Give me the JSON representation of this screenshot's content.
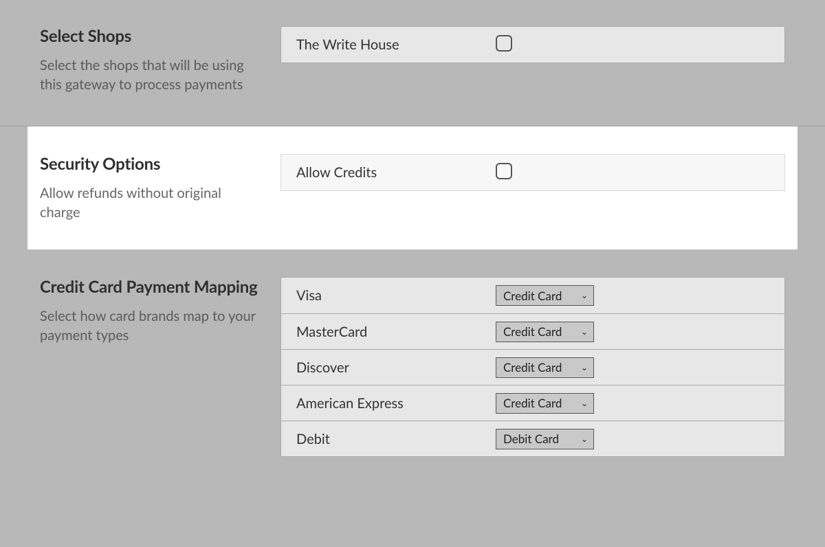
{
  "shops": {
    "title": "Select Shops",
    "desc": "Select the shops that will be using this gateway to process payments",
    "option_label": "The Write House",
    "option_checked": false
  },
  "security": {
    "title": "Security Options",
    "desc": "Allow refunds without original charge",
    "option_label": "Allow Credits",
    "option_checked": false
  },
  "mapping": {
    "title": "Credit Card Payment Mapping",
    "desc": "Select how card brands map to your payment types",
    "rows": [
      {
        "brand": "Visa",
        "value": "Credit Card"
      },
      {
        "brand": "MasterCard",
        "value": "Credit Card"
      },
      {
        "brand": "Discover",
        "value": "Credit Card"
      },
      {
        "brand": "American Express",
        "value": "Credit Card"
      },
      {
        "brand": "Debit",
        "value": "Debit Card"
      }
    ]
  }
}
